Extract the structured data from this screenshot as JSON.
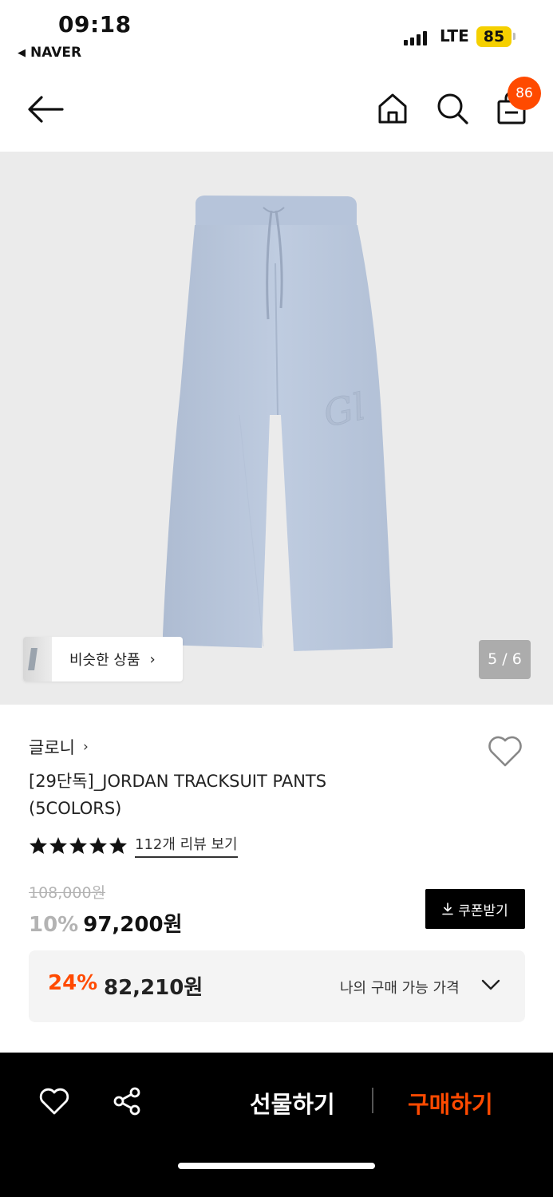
{
  "status_bar": {
    "time": "09:18",
    "back_app": "NAVER",
    "network": "LTE",
    "battery": "85"
  },
  "header": {
    "cart_count": "86",
    "icons": [
      "back-arrow-icon",
      "home-icon",
      "search-icon",
      "shopping-bag-icon"
    ]
  },
  "gallery": {
    "similar_label": "비슷한 상품",
    "counter": "5 / 6",
    "current": 5,
    "total": 6
  },
  "product": {
    "brand": "글로니",
    "title_line1": "[29단독]_JORDAN TRACKSUIT PANTS",
    "title_line2": "(5COLORS)",
    "rating_stars": 5,
    "reviews_link": "112개 리뷰 보기",
    "original_price": "108,000원",
    "discount": "10%",
    "sale_price": "97,200원",
    "coupon_label": "쿠폰받기"
  },
  "best_price": {
    "discount": "24%",
    "price": "82,210원",
    "label": "나의 구매 가능 가격"
  },
  "bottom_bar": {
    "gift_label": "선물하기",
    "buy_label": "구매하기"
  },
  "colors": {
    "accent": "#ff4a00",
    "product_blue": "#b9c7dc",
    "image_bg": "#ebebeb"
  }
}
